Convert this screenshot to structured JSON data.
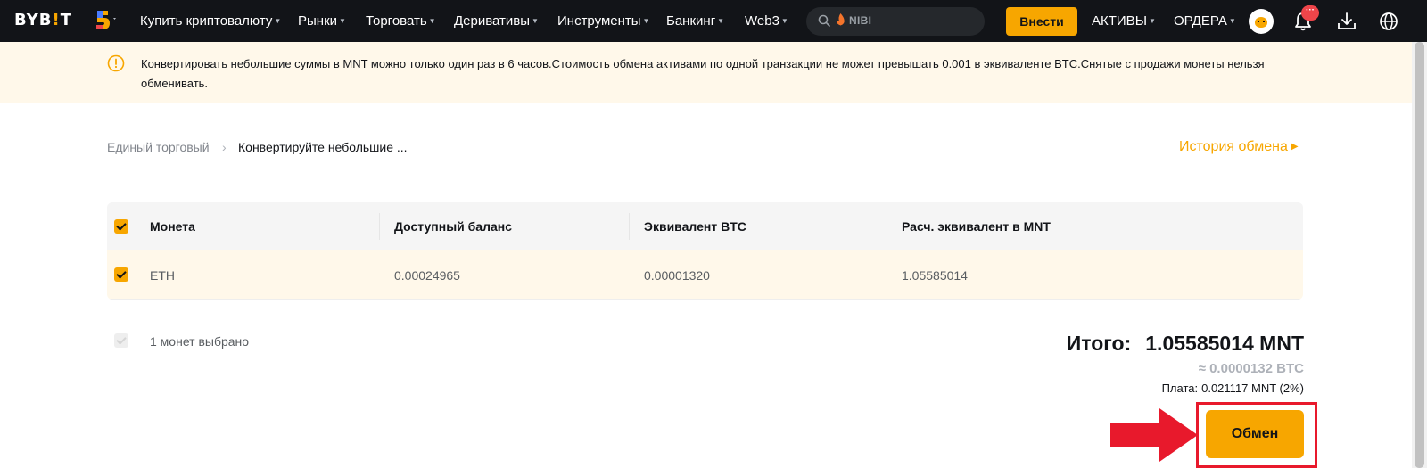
{
  "nav": {
    "logo_prefix": "BYB",
    "logo_bang": "!",
    "logo_suffix": "T",
    "items": [
      {
        "label": "Купить криптовалюту"
      },
      {
        "label": "Рынки"
      },
      {
        "label": "Торговать"
      },
      {
        "label": "Деривативы"
      },
      {
        "label": "Инструменты"
      },
      {
        "label": "Банкинг"
      },
      {
        "label": "Web3"
      }
    ],
    "search_text": "NIBI",
    "deposit_label": "Внести",
    "assets_label": "АКТИВЫ",
    "orders_label": "ОРДЕРА",
    "notification_badge": "···",
    "icons": [
      "five-anniversary-icon",
      "search-icon",
      "fire-icon",
      "avatar",
      "bell-icon",
      "download-icon",
      "globe-icon"
    ]
  },
  "notice": {
    "text": "Конвертировать небольшие суммы в MNT можно только один раз в 6 часов.Стоимость обмена активами по одной транзакции не может превышать 0.001 в эквиваленте BTC.Снятые с продажи монеты нельзя обменивать."
  },
  "breadcrumb": {
    "parent": "Единый торговый",
    "separator": "›",
    "current": "Конвертируйте небольшие ..."
  },
  "history_link": "История обмена",
  "table": {
    "headers": [
      "Монета",
      "Доступный баланс",
      "Эквивалент BTC",
      "Расч. эквивалент в MNT"
    ],
    "rows": [
      {
        "coin": "ETH",
        "balance": "0.00024965",
        "btc": "0.00001320",
        "mnt": "1.05585014"
      }
    ]
  },
  "footer": {
    "selected_text": "1 монет выбрано",
    "total_label": "Итого:",
    "total_value": "1.05585014 MNT",
    "btc_equivalent": "≈ 0.0000132 BTC",
    "fee_label": "Плата:",
    "fee_value": "0.021117 MNT (2%)",
    "exchange_button": "Обмен"
  },
  "colors": {
    "accent": "#f7a600",
    "nav_bg": "#121418",
    "notice_bg": "#fff8ea",
    "annotation_red": "#e8192c"
  }
}
